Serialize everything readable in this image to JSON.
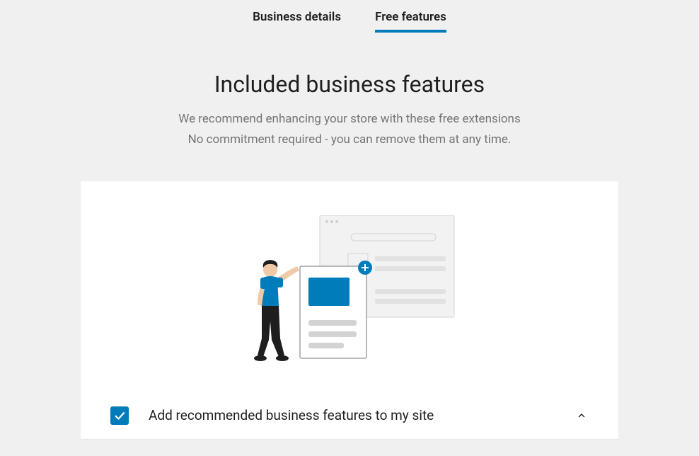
{
  "tabs": [
    {
      "label": "Business details",
      "active": false
    },
    {
      "label": "Free features",
      "active": true
    }
  ],
  "header": {
    "title": "Included business features",
    "subtitle_line1": "We recommend enhancing your store with these free extensions",
    "subtitle_line2": "No commitment required - you can remove them at any time."
  },
  "option": {
    "label": "Add recommended business features to my site",
    "checked": true
  },
  "colors": {
    "accent": "#007cba",
    "page_bg": "#f0f0f1",
    "card_bg": "#ffffff",
    "text": "#1e1e1e",
    "muted": "#757575"
  }
}
